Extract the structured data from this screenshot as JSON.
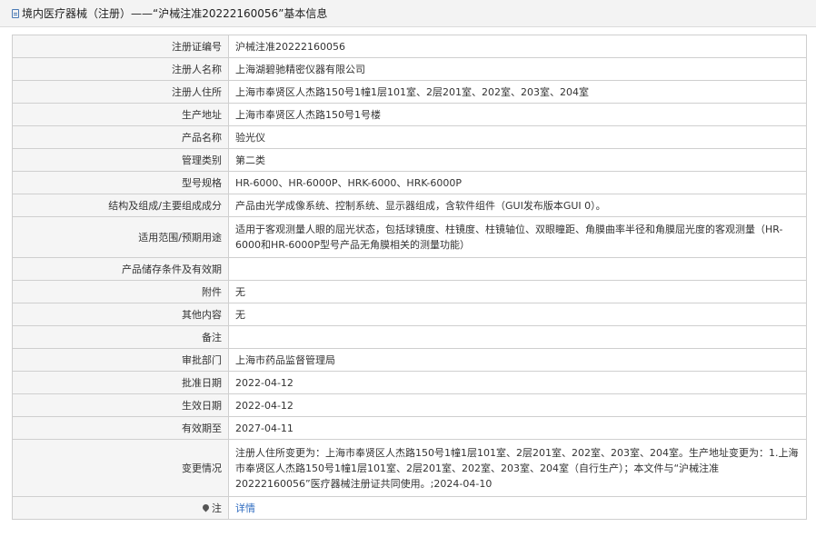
{
  "header": {
    "title": "境内医疗器械（注册）——“沪械注准20222160056”基本信息"
  },
  "rows": [
    {
      "label": "注册证编号",
      "value": "沪械注准20222160056"
    },
    {
      "label": "注册人名称",
      "value": "上海湖碧驰精密仪器有限公司"
    },
    {
      "label": "注册人住所",
      "value": "上海市奉贤区人杰路150号1幢1层101室、2层201室、202室、203室、204室"
    },
    {
      "label": "生产地址",
      "value": "上海市奉贤区人杰路150号1号楼"
    },
    {
      "label": "产品名称",
      "value": "验光仪"
    },
    {
      "label": "管理类别",
      "value": "第二类"
    },
    {
      "label": "型号规格",
      "value": "HR-6000、HR-6000P、HRK-6000、HRK-6000P"
    },
    {
      "label": "结构及组成/主要组成成分",
      "value": "产品由光学成像系统、控制系统、显示器组成，含软件组件（GUI发布版本GUI 0）。"
    },
    {
      "label": "适用范围/预期用途",
      "value": "适用于客观测量人眼的屈光状态，包括球镜度、柱镜度、柱镜轴位、双眼瞳距、角膜曲率半径和角膜屈光度的客观测量（HR-6000和HR-6000P型号产品无角膜相关的测量功能）"
    },
    {
      "label": "产品储存条件及有效期",
      "value": ""
    },
    {
      "label": "附件",
      "value": "无"
    },
    {
      "label": "其他内容",
      "value": "无"
    },
    {
      "label": "备注",
      "value": ""
    },
    {
      "label": "审批部门",
      "value": "上海市药品监督管理局"
    },
    {
      "label": "批准日期",
      "value": "2022-04-12"
    },
    {
      "label": "生效日期",
      "value": "2022-04-12"
    },
    {
      "label": "有效期至",
      "value": "2027-04-11"
    },
    {
      "label": "变更情况",
      "value": "注册人住所变更为：上海市奉贤区人杰路150号1幢1层101室、2层201室、202室、203室、204室。生产地址变更为：1.上海市奉贤区人杰路150号1幢1层101室、2层201室、202室、203室、204室（自行生产）；本文件与“沪械注准20222160056”医疗器械注册证共同使用。;2024-04-10"
    }
  ],
  "note_row": {
    "label": "注",
    "link": "详情"
  }
}
